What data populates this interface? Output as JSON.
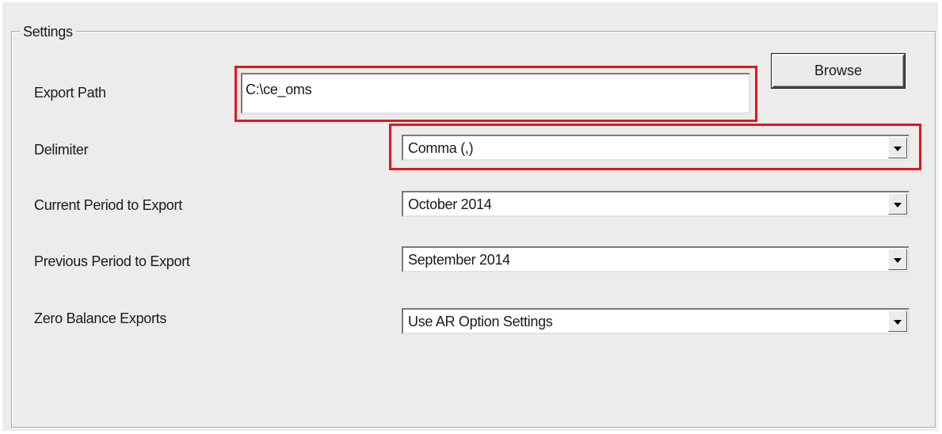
{
  "settings": {
    "group_title": "Settings",
    "export_path": {
      "label": "Export Path",
      "value": "C:\\ce_oms"
    },
    "browse_label": "Browse",
    "delimiter": {
      "label": "Delimiter",
      "selected": "Comma (,)"
    },
    "current_period": {
      "label": "Current Period to Export",
      "selected": "October 2014"
    },
    "previous_period": {
      "label": "Previous Period to Export",
      "selected": "September 2014"
    },
    "zero_balance": {
      "label": "Zero Balance Exports",
      "selected": "Use AR Option Settings"
    }
  },
  "icons": {
    "dropdown": "chevron-down-icon"
  },
  "colors": {
    "highlight": "#e8141c",
    "panel_background": "#ececec",
    "field_background": "#ffffff"
  }
}
